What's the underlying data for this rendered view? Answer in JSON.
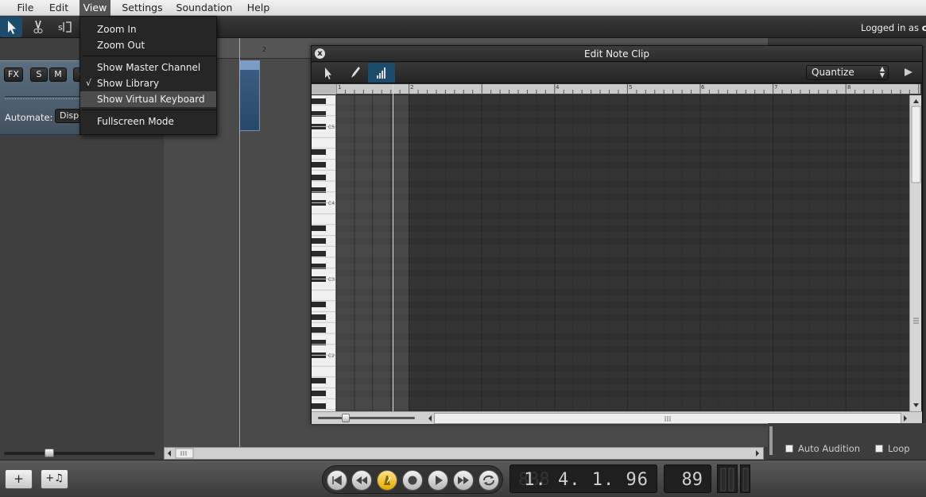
{
  "menubar": {
    "items": [
      "File",
      "Edit",
      "View",
      "Settings",
      "Soundation",
      "Help"
    ],
    "active": "View"
  },
  "toolbar": {
    "tools": [
      "pointer-tool",
      "cut-tool",
      "slip-tool"
    ],
    "logged_in_label": "Logged in as",
    "username": "cec"
  },
  "view_menu": {
    "zoom_in": "Zoom In",
    "zoom_out": "Zoom Out",
    "show_master_channel": "Show Master Channel",
    "show_library": "Show Library",
    "show_library_checked": true,
    "check_mark": "√",
    "show_virtual_keyboard": "Show Virtual Keyboard",
    "fullscreen_mode": "Fullscreen Mode",
    "highlighted": "Show Virtual Keyboard"
  },
  "track": {
    "fx": "FX",
    "solo": "S",
    "mute": "M",
    "extra": "C",
    "automate_label": "Automate:",
    "automate_value": "Disp"
  },
  "arrange_ruler": {
    "marks": [
      "2"
    ]
  },
  "note_window": {
    "title": "Edit Note Clip",
    "close": "x",
    "quantize": "Quantize",
    "ruler_marks": [
      "1",
      "2",
      "4",
      "5",
      "6",
      "7",
      "8"
    ],
    "octave_labels": [
      "C5",
      "C4",
      "C3",
      "C2"
    ]
  },
  "options": {
    "auto_audition": "Auto Audition",
    "loop": "Loop"
  },
  "bottom": {
    "add_track": "+",
    "add_instrument": "+♫"
  },
  "transport": {
    "buttons": [
      "rewind-to-start",
      "rewind",
      "metronome",
      "record",
      "play",
      "fast-forward",
      "loop"
    ],
    "position": "1. 4. 1.  96",
    "position_ghost": "888",
    "tempo": "89"
  },
  "colors": {
    "accent": "#1d4b6b",
    "menu_highlight": "#4c4c4c",
    "metronome_active": "#e5a800"
  }
}
